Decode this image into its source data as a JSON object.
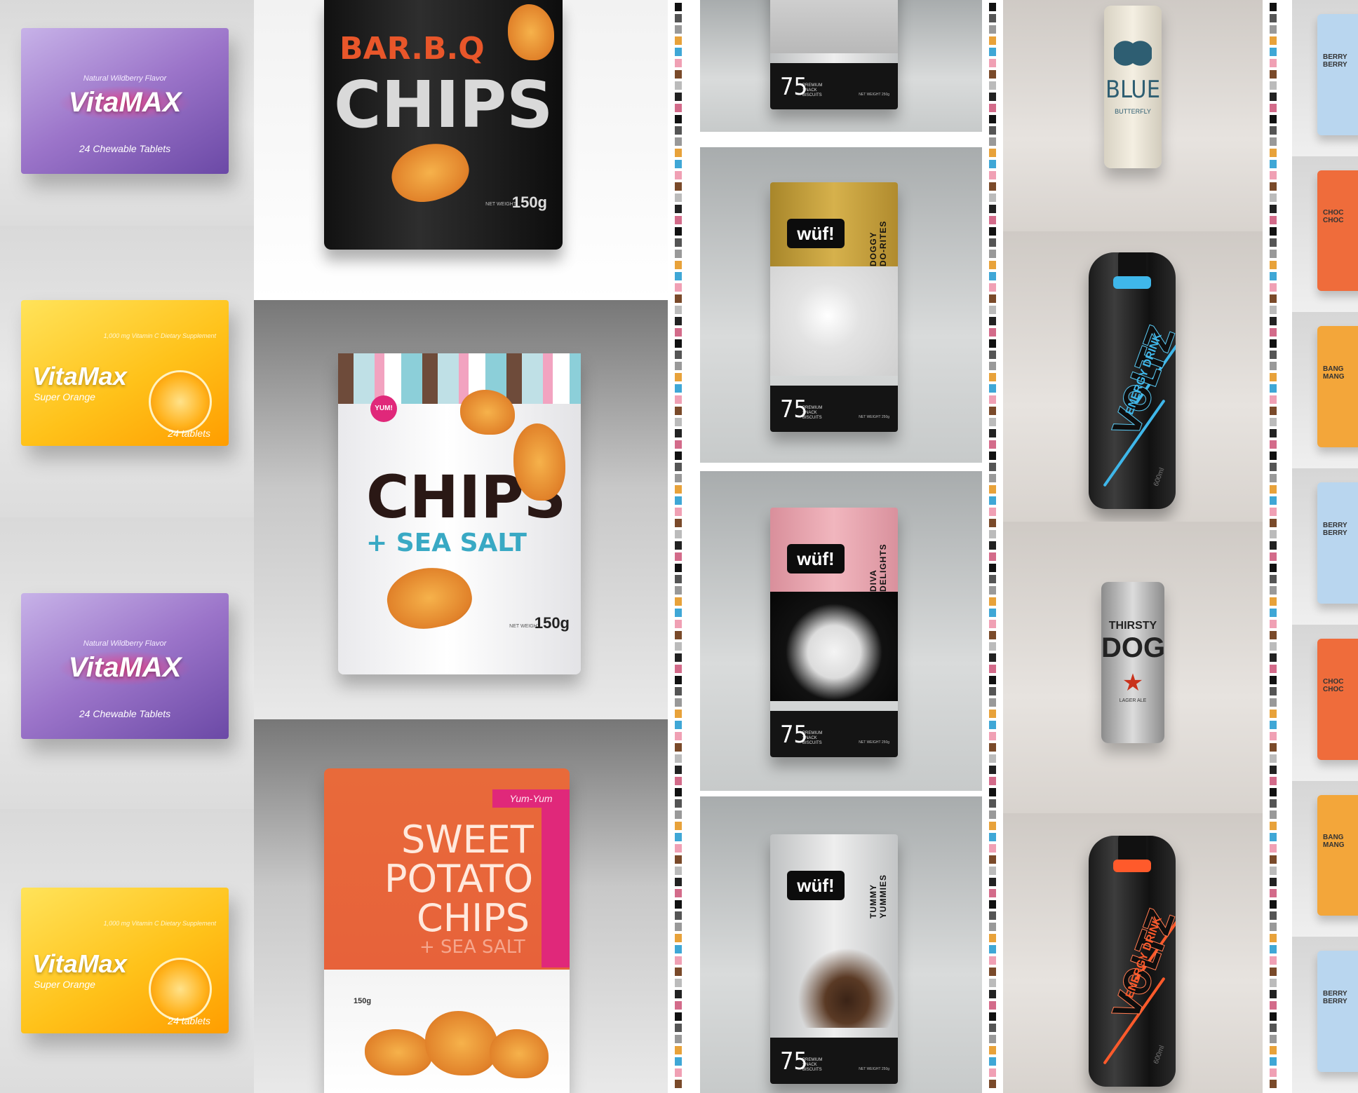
{
  "vitamins": {
    "purple": {
      "brand": "VitaMAX",
      "flavor": "Natural Wildberry Flavor",
      "subtitle": "24 Chewable Tablets",
      "color": "#9b74c9"
    },
    "orange": {
      "brand": "VitaMax",
      "flavor": "1,000 mg Vitamin C Dietary Supplement",
      "subtitle": "Super Orange",
      "tablets": "24 tablets",
      "color": "#ffc21a"
    }
  },
  "chips": {
    "bbq": {
      "line1": "BAR.B.Q",
      "line2": "CHIPS",
      "weight_label": "NET WEIGHT",
      "weight": "150g"
    },
    "seasalt": {
      "badge": "YUM!",
      "line1": "CHIPS",
      "line2": "+ SEA SALT",
      "weight_label": "NET WEIGHT",
      "weight": "150g"
    },
    "sweet": {
      "badge": "Yum-Yum",
      "line1": "SWEET",
      "line2": "POTATO",
      "line3": "CHIPS",
      "line4": "+ SEA SALT",
      "weight": "150g"
    }
  },
  "dogfood": {
    "brand": "wüf!",
    "number": "75",
    "small": "PREMIUM SNACK BISCUITS",
    "weight": "NET WEIGHT 250g",
    "variants": [
      "DOGGY DO-RITES",
      "DIVA DELIGHTS",
      "TUMMY YUMMIES"
    ],
    "colors": {
      "gold": "#c9a43f",
      "pink": "#e9a7b0",
      "silver": "#cfd1d2"
    }
  },
  "drinks": {
    "blue_can": {
      "line1": "BLUE",
      "line2": "BUTTERFLY"
    },
    "thirsty_can": {
      "line1": "THIRSTY",
      "line2": "DOG",
      "line3": "LAGER ALE"
    },
    "voltz": {
      "brand": "VOLTZ",
      "sub": "ENERGY DRINK",
      "volume": "600ml"
    },
    "accent_blue": "#3fb7ea",
    "accent_red": "#ff5a2b"
  },
  "right_bags": {
    "labels": [
      "BERRY BERRY",
      "CHOC CHOC",
      "BANG MANG",
      "BERRY BERRY",
      "CHOC CHOC",
      "BANG MANG",
      "BERRY BERRY"
    ]
  }
}
